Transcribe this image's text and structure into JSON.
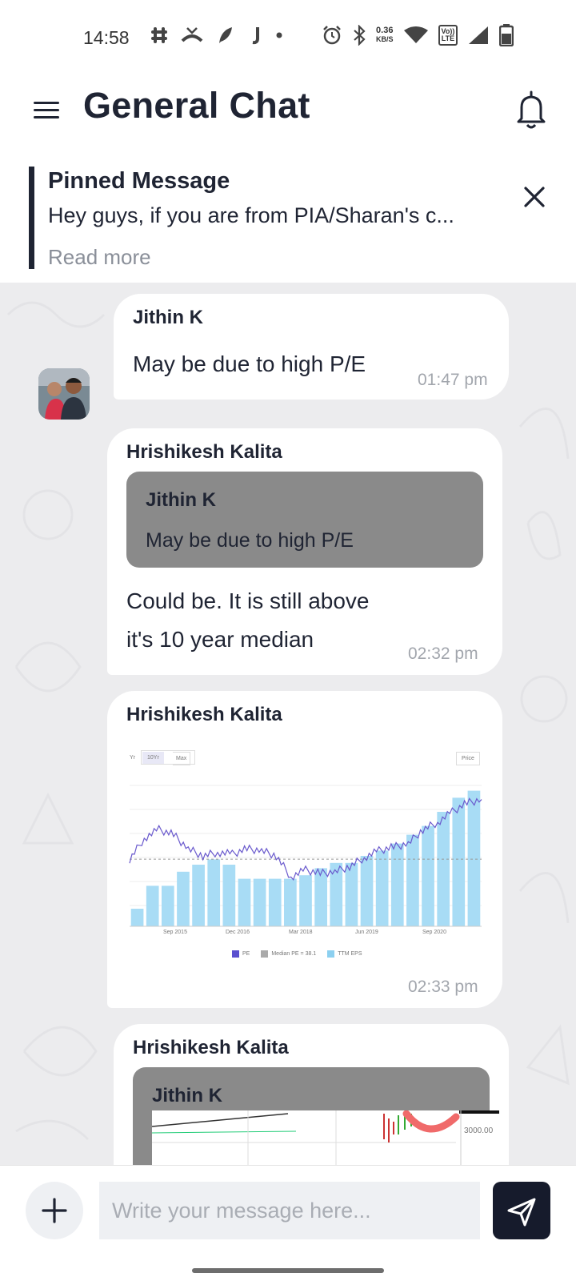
{
  "status_bar": {
    "time": "14:58",
    "speed_value": "0.36",
    "speed_unit": "KB/S",
    "lte_top": "Vo))",
    "lte_bottom": "LTE",
    "left_icons": [
      "slack-icon",
      "missed-call-icon",
      "feather-icon",
      "j-icon",
      "dot-icon"
    ],
    "right_icons": [
      "alarm-icon",
      "bluetooth-icon",
      "wifi-icon",
      "signal-icon",
      "battery-icon"
    ]
  },
  "header": {
    "title": "General Chat"
  },
  "pinned": {
    "title": "Pinned Message",
    "text": "Hey guys, if you are from PIA/Sharan's c...",
    "read_more": "Read more"
  },
  "messages": [
    {
      "sender": "Jithin K",
      "text": "May be due to high P/E",
      "time": "01:47 pm"
    },
    {
      "sender": "Hrishikesh Kalita",
      "quote_sender": "Jithin K",
      "quote_text": "May be due to high P/E",
      "text_line1": "Could be. It is still above",
      "text_line2": "it's 10 year median",
      "time": "02:32 pm"
    },
    {
      "sender": "Hrishikesh Kalita",
      "time": "02:33 pm",
      "image_chart": {
        "range_tabs": [
          "Yr",
          "10Yr",
          "Max"
        ],
        "selected_tab": "10Yr",
        "price_label": "Price",
        "x_ticks": [
          "Sep 2015",
          "Dec 2016",
          "Mar 2018",
          "Jun 2019",
          "Sep 2020"
        ],
        "legend": [
          "PE",
          "Median PE = 38.1",
          "TTM EPS"
        ]
      }
    },
    {
      "sender": "Hrishikesh Kalita",
      "quote_sender": "Jithin K",
      "quote_image_label": "3000.00"
    }
  ],
  "chart_data": {
    "type": "bar",
    "categories": [
      "Sep 2015",
      "Dec 2016",
      "Mar 2018",
      "Jun 2019",
      "Sep 2020"
    ],
    "series": [
      {
        "name": "TTM EPS",
        "values": [
          10,
          23,
          23,
          31,
          35,
          38,
          35,
          27,
          27,
          27,
          27,
          29,
          33,
          36,
          36,
          40,
          43,
          47,
          52,
          57,
          65,
          73,
          77
        ]
      },
      {
        "name": "PE",
        "values": [
          38,
          50,
          55,
          52,
          44,
          40,
          42,
          41,
          44,
          43,
          40,
          28,
          32,
          30,
          31,
          34,
          39,
          43,
          45,
          47,
          55,
          59,
          65,
          70,
          72
        ]
      }
    ],
    "reference_lines": [
      {
        "name": "Median PE = 38.1",
        "value": 38.1
      }
    ],
    "ylim": [
      0,
      80
    ],
    "legend_position": "bottom"
  },
  "input": {
    "placeholder": "Write your message here..."
  },
  "colors": {
    "accent": "#161b2c",
    "bar": "#a8dcf5",
    "line": "#6a5acd",
    "quote_bg": "#8a8a8a",
    "chat_bg": "#ececee"
  }
}
